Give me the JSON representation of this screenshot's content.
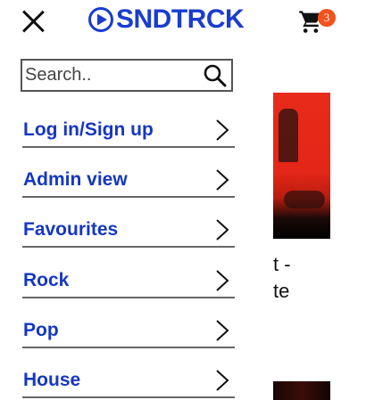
{
  "header": {
    "logo_text": "SNDTRCK",
    "cart_count": "3",
    "brand_color": "#1a3ccf",
    "badge_color": "#f4511e"
  },
  "menu": {
    "search": {
      "placeholder": "Search..",
      "value": ""
    },
    "items": [
      {
        "label": "Log in/Sign up"
      },
      {
        "label": "Admin view"
      },
      {
        "label": "Favourites"
      },
      {
        "label": "Rock"
      },
      {
        "label": "Pop"
      },
      {
        "label": "House"
      }
    ],
    "label_color": "#1537c2"
  },
  "background": {
    "text": "t -\nte"
  }
}
